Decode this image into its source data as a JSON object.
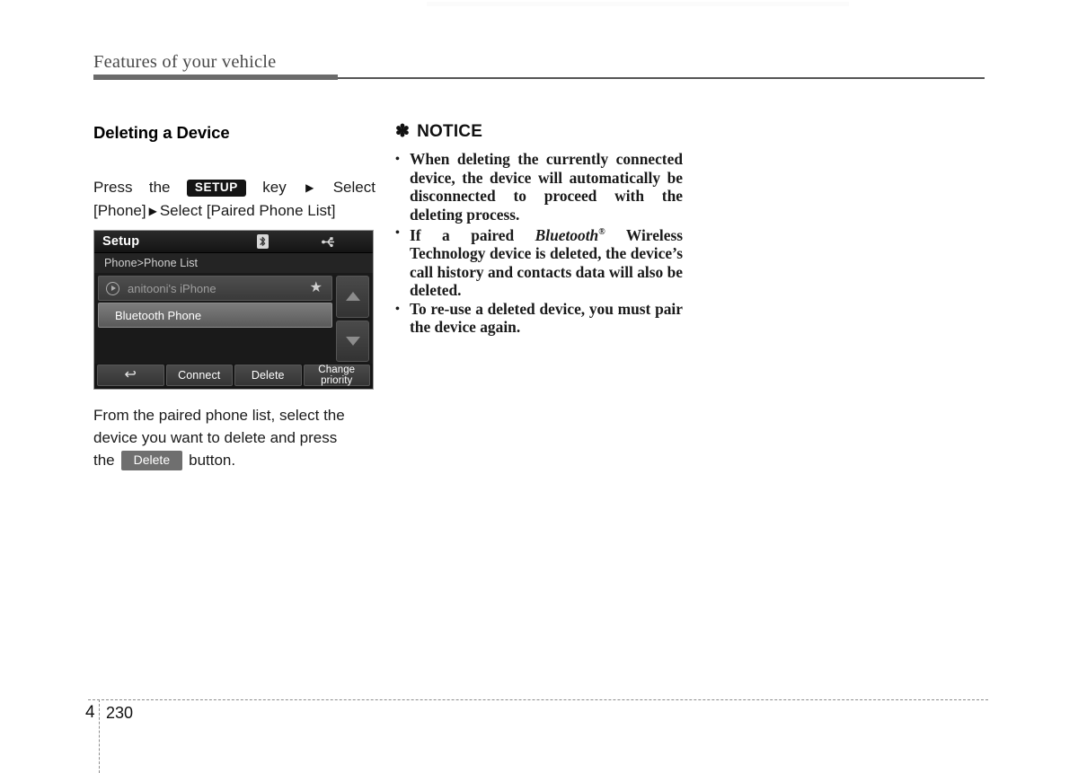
{
  "header": {
    "running_title": "Features of your vehicle"
  },
  "left_column": {
    "section_title": "Deleting a Device",
    "nav_path": {
      "press_word": "Press",
      "the_word": "the",
      "setup_badge": "SETUP",
      "key_word": "key",
      "arrow": "▶",
      "select_word_1": "Select",
      "bracket_phone": "[Phone]",
      "select_word_2": "Select [Paired Phone List]"
    },
    "caption": {
      "line1": "From the paired phone list, select the",
      "line2": "device you want to delete and press",
      "line3_prefix": "the",
      "delete_badge": "Delete",
      "line3_suffix": "button."
    }
  },
  "device_screen": {
    "title": "Setup",
    "status_icons": [
      "bluetooth-icon",
      "usb-icon"
    ],
    "breadcrumb": "Phone>Phone List",
    "rows": [
      {
        "label": "anitooni's iPhone",
        "leading_icon": "play-icon",
        "trailing_icon": "star-icon",
        "state": "connected"
      },
      {
        "label": "Bluetooth Phone",
        "leading_icon": "",
        "trailing_icon": "",
        "state": "selected"
      }
    ],
    "scroll": {
      "up_icon": "triangle-up-icon",
      "down_icon": "triangle-down-icon"
    },
    "toolbar": [
      {
        "label": "↩",
        "name": "back-button",
        "two_line": false
      },
      {
        "label": "Connect",
        "name": "connect-button",
        "two_line": false
      },
      {
        "label": "Delete",
        "name": "delete-button",
        "two_line": false
      },
      {
        "label": "Change\npriority",
        "name": "change-priority-button",
        "two_line": true
      }
    ]
  },
  "right_column": {
    "notice_symbol": "✽",
    "notice_title": "NOTICE",
    "bullet_symbol": "•",
    "items": [
      "When deleting the currently connected device, the device will automatically be disconnected to proceed with the deleting process.",
      "If a paired Bluetooth® Wireless Technology device is deleted, the device's call history and contacts data will also be deleted.",
      "To re-use a deleted device, you must pair the device again."
    ]
  },
  "footer": {
    "chapter": "4",
    "page": "230"
  }
}
